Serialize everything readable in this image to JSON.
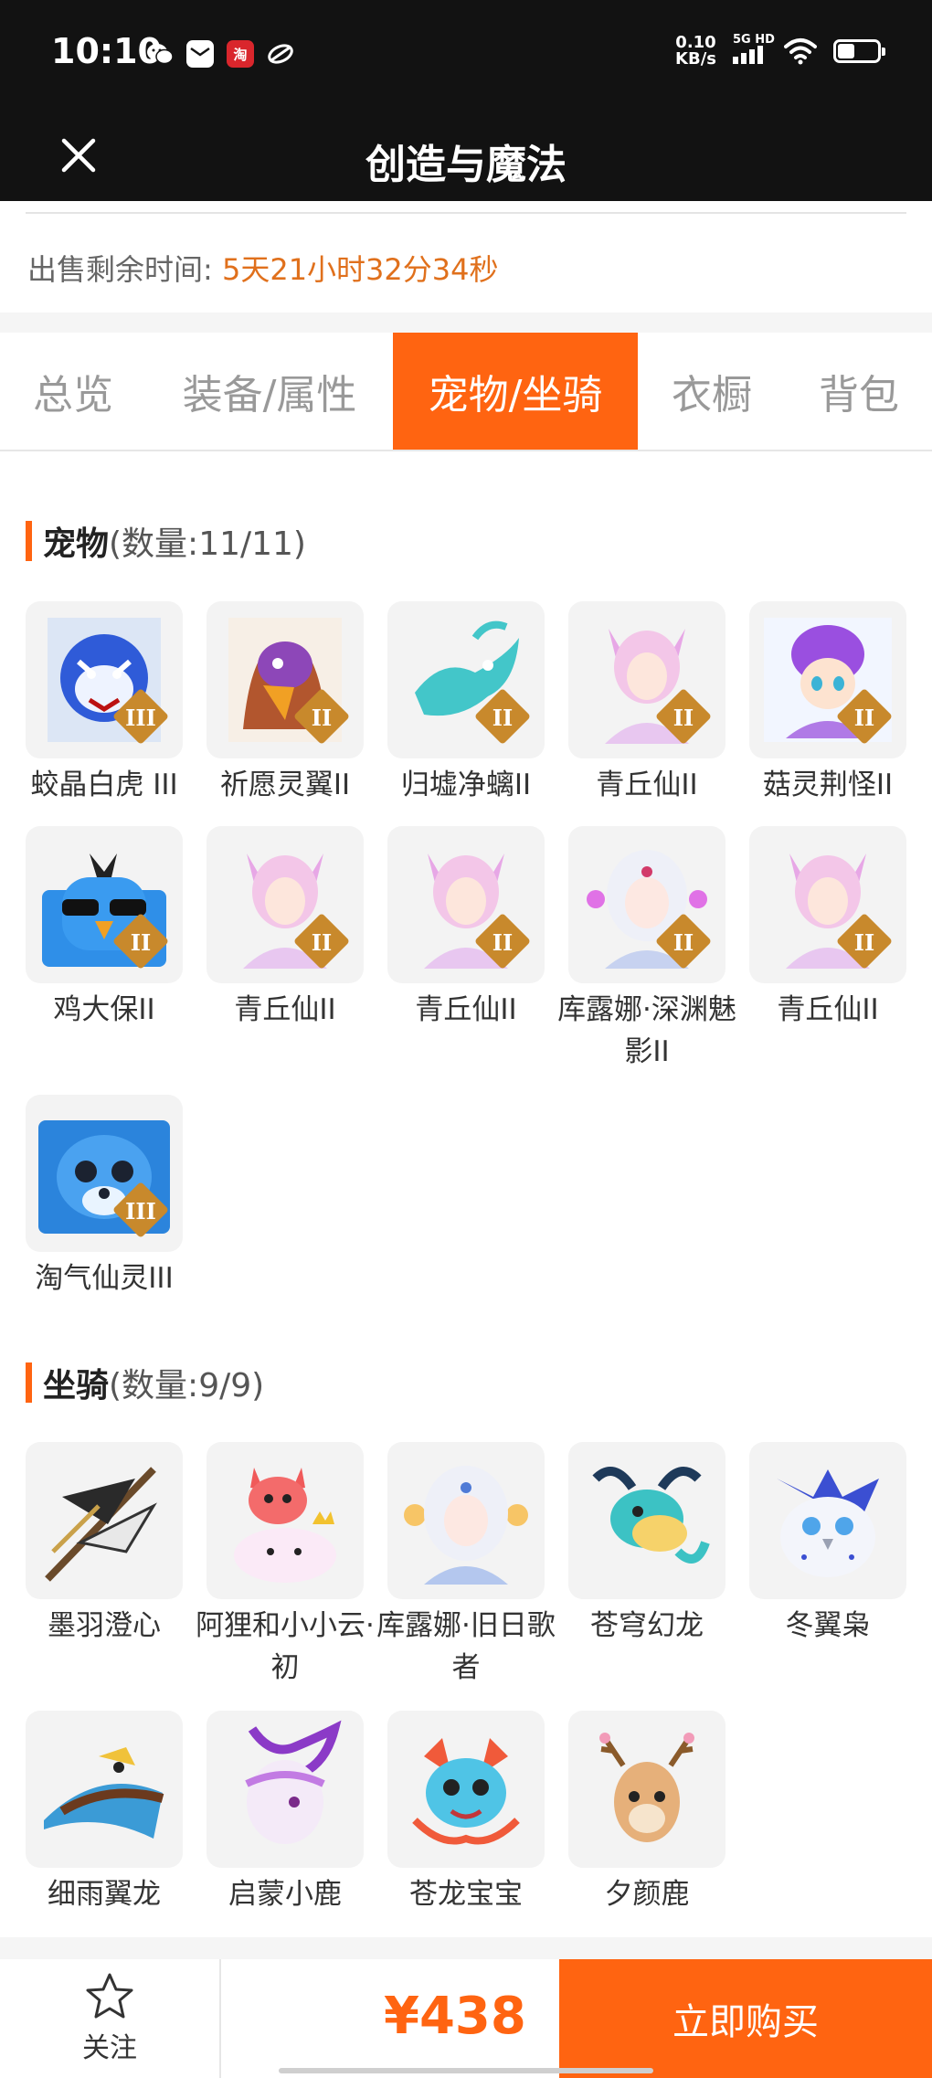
{
  "status_bar": {
    "time": "10:10",
    "net_speed_value": "0.10",
    "net_speed_unit": "KB/s",
    "signal_label": "5G HD",
    "taobao_icon_text": "淘",
    "app_icons": [
      "wechat-icon",
      "mail-icon",
      "taobao-icon",
      "leaf-icon"
    ]
  },
  "header": {
    "title": "创造与魔法",
    "close_icon": "close-icon"
  },
  "sale": {
    "label": "出售剩余时间:",
    "remaining": "5天21小时32分34秒"
  },
  "tabs": [
    {
      "label": "总览",
      "active": false
    },
    {
      "label": "装备/属性",
      "active": false
    },
    {
      "label": "宠物/坐骑",
      "active": true
    },
    {
      "label": "衣橱",
      "active": false
    },
    {
      "label": "背包",
      "active": false
    }
  ],
  "pets": {
    "title": "宠物",
    "count": "(数量:11/11)",
    "items": [
      {
        "name": "蛟晶白虎 III",
        "badge": "III"
      },
      {
        "name": "祈愿灵翼II",
        "badge": "II"
      },
      {
        "name": "归墟净螭II",
        "badge": "II"
      },
      {
        "name": "青丘仙II",
        "badge": "II"
      },
      {
        "name": "菇灵荆怪II",
        "badge": "II"
      },
      {
        "name": "鸡大保II",
        "badge": "II"
      },
      {
        "name": "青丘仙II",
        "badge": "II"
      },
      {
        "name": "青丘仙II",
        "badge": "II"
      },
      {
        "name": "库露娜·深渊魅影II",
        "badge": "II"
      },
      {
        "name": "青丘仙II",
        "badge": "II"
      },
      {
        "name": "淘气仙灵III",
        "badge": "III"
      }
    ]
  },
  "mounts": {
    "title": "坐骑",
    "count": "(数量:9/9)",
    "items": [
      {
        "name": "墨羽澄心"
      },
      {
        "name": "阿狸和小小云·初"
      },
      {
        "name": "库露娜·旧日歌者"
      },
      {
        "name": "苍穹幻龙"
      },
      {
        "name": "冬翼枭"
      },
      {
        "name": "细雨翼龙"
      },
      {
        "name": "启蒙小鹿"
      },
      {
        "name": "苍龙宝宝"
      },
      {
        "name": "夕颜鹿"
      }
    ]
  },
  "footer": {
    "follow_label": "关注",
    "price": "¥438",
    "buy_label": "立即购买"
  },
  "colors": {
    "accent": "#ff6411",
    "time_highlight": "#e0701c",
    "header_bg": "#121212"
  }
}
